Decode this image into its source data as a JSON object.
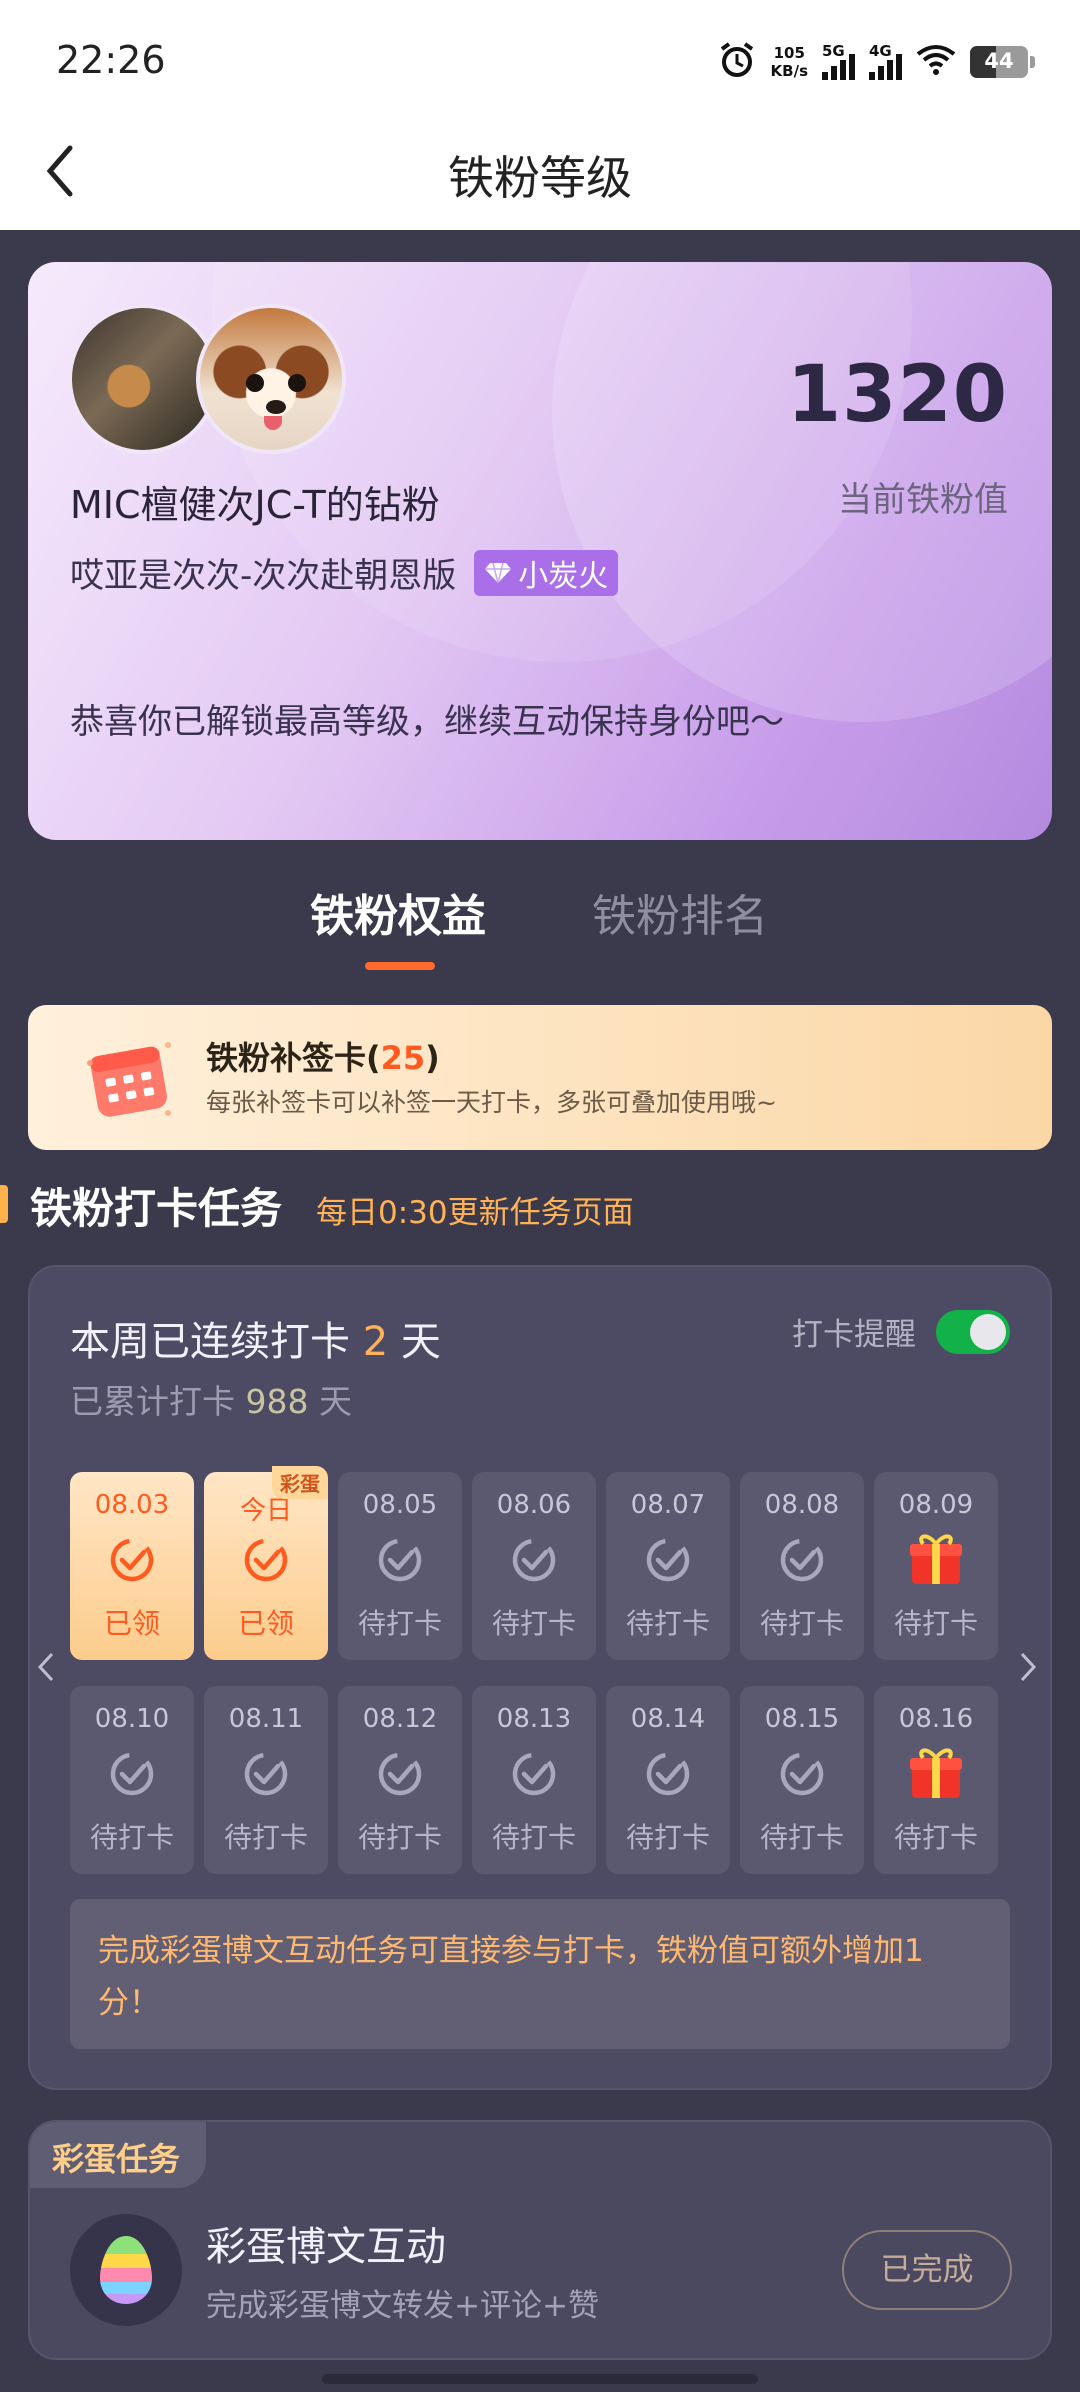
{
  "status_bar": {
    "time": "22:26",
    "net_speed": "105",
    "net_unit": "KB/s",
    "net1": "5G",
    "net2": "4G",
    "battery": "44"
  },
  "nav": {
    "title": "铁粉等级"
  },
  "header": {
    "name": "MIC檀健次JC-T的钻粉",
    "nickname": "哎亚是次次-次次赴朝恩版",
    "badge": "小炭火",
    "score": "1320",
    "score_label": "当前铁粉值",
    "congrats": "恭喜你已解锁最高等级，继续互动保持身份吧～"
  },
  "tabs": [
    {
      "label": "铁粉权益"
    },
    {
      "label": "铁粉排名"
    }
  ],
  "makeup_card": {
    "title": "铁粉补签卡(",
    "count": "25",
    "title_end": ")",
    "desc": "每张补签卡可以补签一天打卡，多张可叠加使用哦~"
  },
  "section": {
    "title": "铁粉打卡任务",
    "hint": "每日0:30更新任务页面"
  },
  "checkin": {
    "streak_prefix": "本周已连续打卡 ",
    "streak_days": "2",
    "streak_suffix": " 天",
    "total_prefix": "已累计打卡 ",
    "total_days": "988",
    "total_suffix": " 天",
    "reminder_label": "打卡提醒",
    "reminder_on": true,
    "egg_tag": "彩蛋",
    "row1": [
      {
        "date": "08.03",
        "status": "已领"
      },
      {
        "date": "今日",
        "status": "已领"
      },
      {
        "date": "08.05",
        "status": "待打卡"
      },
      {
        "date": "08.06",
        "status": "待打卡"
      },
      {
        "date": "08.07",
        "status": "待打卡"
      },
      {
        "date": "08.08",
        "status": "待打卡"
      },
      {
        "date": "08.09",
        "status": "待打卡"
      }
    ],
    "row2": [
      {
        "date": "08.10",
        "status": "待打卡"
      },
      {
        "date": "08.11",
        "status": "待打卡"
      },
      {
        "date": "08.12",
        "status": "待打卡"
      },
      {
        "date": "08.13",
        "status": "待打卡"
      },
      {
        "date": "08.14",
        "status": "待打卡"
      },
      {
        "date": "08.15",
        "status": "待打卡"
      },
      {
        "date": "08.16",
        "status": "待打卡"
      }
    ],
    "notice": "完成彩蛋博文互动任务可直接参与打卡，铁粉值可额外增加1分！"
  },
  "egg_task": {
    "tag": "彩蛋任务",
    "title": "彩蛋博文互动",
    "desc": "完成彩蛋博文转发+评论+赞",
    "button": "已完成"
  },
  "colors": {
    "accent": "#ff6a2c",
    "bg": "#3b3a4c",
    "card": "#4d4b63",
    "toggle_on": "#13b14a"
  }
}
